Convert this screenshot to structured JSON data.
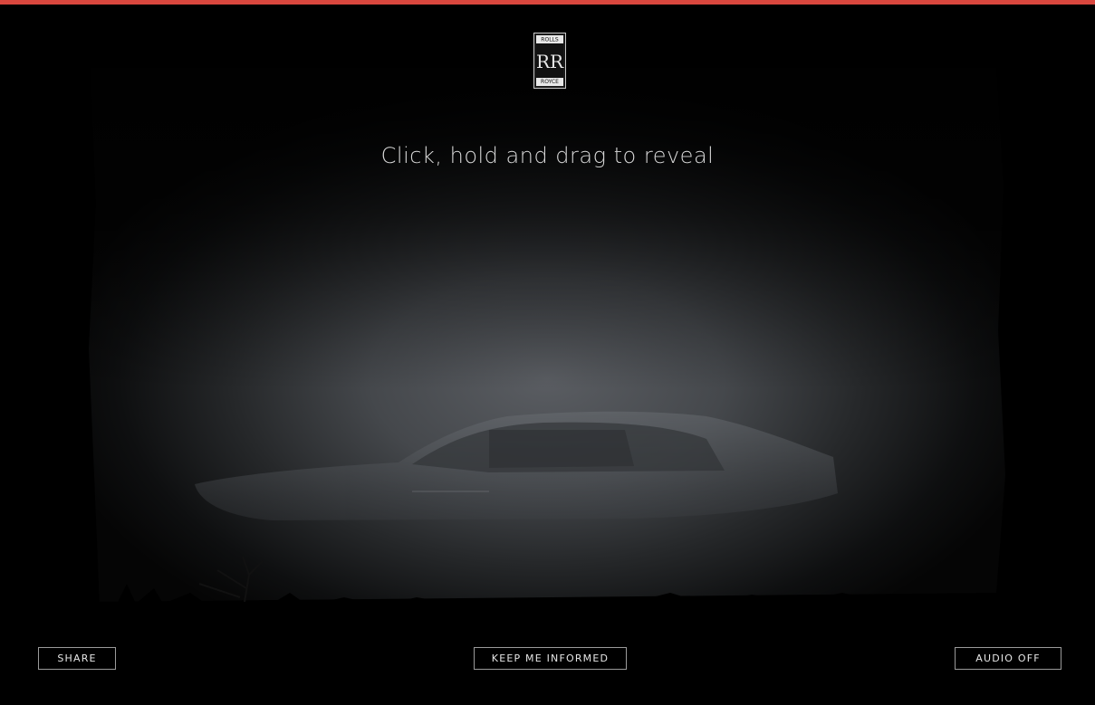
{
  "headline": "Click, hold and drag to reveal",
  "logo": {
    "top_text": "ROLLS",
    "monogram": "RR",
    "bottom_text": "ROYCE"
  },
  "buttons": {
    "share": "SHARE",
    "keep_informed": "KEEP ME INFORMED",
    "audio": "AUDIO OFF"
  },
  "colors": {
    "accent_bar": "#d9473e",
    "background": "#000000",
    "text": "#d8d8d8"
  }
}
